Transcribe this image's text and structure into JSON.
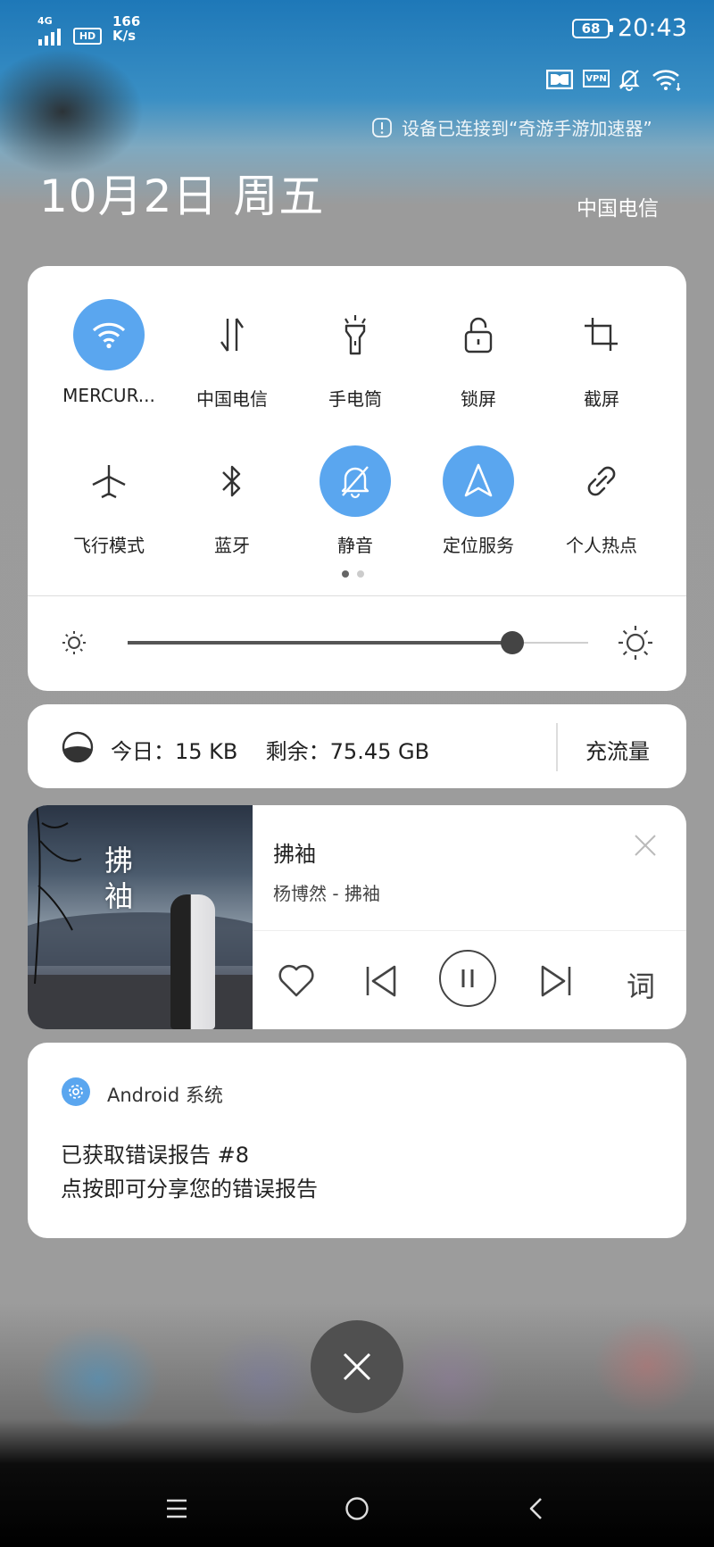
{
  "status_bar": {
    "network_type": "4G",
    "hd_badge": "HD",
    "speed_value": "166",
    "speed_unit": "K/s",
    "battery": "68",
    "time": "20:43",
    "vpn_badge": "VPN"
  },
  "connection_notice": "设备已连接到“奇游手游加速器”",
  "header": {
    "date": "10月2日 周五",
    "carrier": "中国电信"
  },
  "quick_settings": {
    "tiles": [
      {
        "label": "MERCUR...",
        "icon": "wifi-icon",
        "active": true
      },
      {
        "label": "中国电信",
        "icon": "mobile-data-icon",
        "active": false
      },
      {
        "label": "手电筒",
        "icon": "flashlight-icon",
        "active": false
      },
      {
        "label": "锁屏",
        "icon": "lock-icon",
        "active": false
      },
      {
        "label": "截屏",
        "icon": "screenshot-icon",
        "active": false
      },
      {
        "label": "飞行模式",
        "icon": "airplane-icon",
        "active": false
      },
      {
        "label": "蓝牙",
        "icon": "bluetooth-icon",
        "active": false
      },
      {
        "label": "静音",
        "icon": "mute-icon",
        "active": true
      },
      {
        "label": "定位服务",
        "icon": "location-icon",
        "active": true
      },
      {
        "label": "个人热点",
        "icon": "hotspot-icon",
        "active": false
      }
    ],
    "page_count": 2,
    "current_page": 1,
    "brightness": 0.835
  },
  "data_usage": {
    "today_label": "今日：",
    "today_value": "15 KB",
    "remaining_label": "剩余：",
    "remaining_value": "75.45 GB",
    "recharge_label": "充流量"
  },
  "media": {
    "title": "拂袖",
    "subtitle": "杨博然 - 拂袖",
    "album_art_text": "拂袖",
    "lyrics_label": "词"
  },
  "notification": {
    "app_name": "Android 系统",
    "line1": "已获取错误报告 #8",
    "line2": "点按即可分享您的错误报告"
  },
  "colors": {
    "accent": "#5aa6ef",
    "card": "#ffffff",
    "text": "#222222"
  }
}
